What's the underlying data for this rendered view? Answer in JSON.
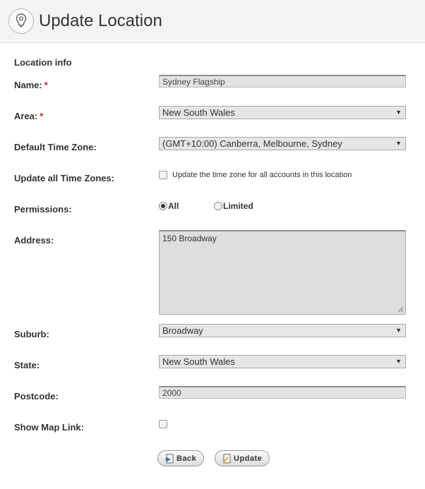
{
  "header": {
    "title": "Update Location",
    "icon": "map-pin-icon"
  },
  "form": {
    "section_title": "Location info",
    "required_marker": "*",
    "name": {
      "label": "Name:",
      "value": "Sydney Flagship"
    },
    "area": {
      "label": "Area:",
      "value": "New South Wales"
    },
    "time_zone": {
      "label": "Default Time Zone:",
      "value": "(GMT+10:00) Canberra, Melbourne, Sydney"
    },
    "update_all_tz": {
      "label": "Update all Time Zones:",
      "checkbox_label": "Update the time zone for all accounts in this location",
      "checked": false
    },
    "permissions": {
      "label": "Permissions:",
      "options": [
        "All",
        "Limited"
      ],
      "selected": "All"
    },
    "address": {
      "label": "Address:",
      "value": "150 Broadway"
    },
    "suburb": {
      "label": "Suburb:",
      "value": "Broadway"
    },
    "state": {
      "label": "State:",
      "value": "New South Wales"
    },
    "postcode": {
      "label": "Postcode:",
      "value": "2000"
    },
    "show_map_link": {
      "label": "Show Map Link:",
      "checked": false
    }
  },
  "buttons": {
    "back": "Back",
    "update": "Update"
  },
  "colors": {
    "required": "#d21f1f",
    "header_bg": "#f4f4f4",
    "field_bg": "#e3e3e3"
  }
}
